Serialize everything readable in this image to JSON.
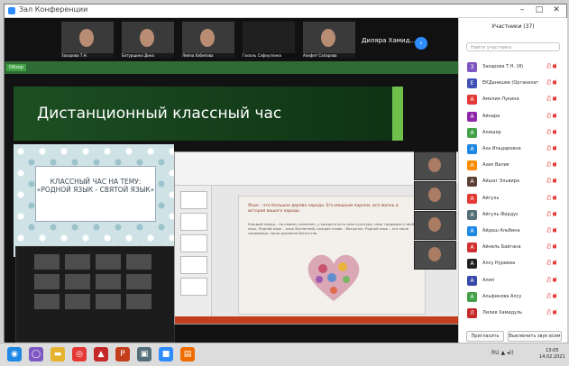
{
  "window": {
    "title": "Зал Конференции"
  },
  "gallery": {
    "participants": [
      {
        "name": "Захарова Т.Н."
      },
      {
        "name": "Ботурщина Дина"
      },
      {
        "name": "Лейла Хабипова"
      },
      {
        "name": ""
      },
      {
        "name": "Гюзаль Сафиуллина"
      },
      {
        "name": "Алифет Сапарова"
      }
    ],
    "speaker_name": "Диляра Хамид...",
    "next_icon": "chevron-right-icon"
  },
  "share": {
    "toolbar_badge": "Обзор",
    "title_slide": "Дистанционный классный час",
    "card_text": "КЛАССНЫЙ ЧАС НА ТЕМУ: «РОДНОЙ ЯЗЫК - СВЯТОЙ ЯЗЫК»",
    "ppt_slide_heading": "Язык – это большое дерево народа. Его мощным корнем, вся жизнь и история вашего народа",
    "ppt_slide_body": "Каждый народ – по-своему уникален, у каждого есть своя культура, свои традиции и свой язык. Родной язык – язык Вселенной, каждое слово – бесценно. Родной язык – это наше сокровище, наше духовное богатство."
  },
  "panel": {
    "title": "Участники (37)",
    "search_placeholder": "Найти участника",
    "participants": [
      {
        "name": "Захарова Т.Н. (Я)",
        "color": "#7e57c2",
        "letter": "З"
      },
      {
        "name": "ЕКДанишев (Организатор)",
        "color": "#3f51b5",
        "letter": "Е"
      },
      {
        "name": "Амелия Лукина",
        "color": "#e53935",
        "letter": "А"
      },
      {
        "name": "Айнара",
        "color": "#8e24aa",
        "letter": "А"
      },
      {
        "name": "Алишер",
        "color": "#43a047",
        "letter": "А"
      },
      {
        "name": "Аза Ильдаровна",
        "color": "#1e88e5",
        "letter": "А"
      },
      {
        "name": "Азик Валик",
        "color": "#fb8c00",
        "letter": "А"
      },
      {
        "name": "Айшат Эльвира",
        "color": "#5d4037",
        "letter": "А"
      },
      {
        "name": "Айгуль",
        "color": "#e53935",
        "letter": "А"
      },
      {
        "name": "Айгуль Фирдус",
        "color": "#546e7a",
        "letter": "А"
      },
      {
        "name": "Айдаш Альбина",
        "color": "#1e88e5",
        "letter": "А"
      },
      {
        "name": "Айнель Байгана",
        "color": "#d32f2f",
        "letter": "А"
      },
      {
        "name": "Алсу Нуриева",
        "color": "#212121",
        "letter": "А"
      },
      {
        "name": "Алия",
        "color": "#3949ab",
        "letter": "А"
      },
      {
        "name": "Альфинова Алсу",
        "color": "#43a047",
        "letter": "А"
      },
      {
        "name": "Лилия Хамидуль",
        "color": "#c62828",
        "letter": "Л"
      }
    ],
    "invite_button": "Пригласить",
    "mute_all_button": "Выключить звук всем"
  },
  "taskbar": {
    "apps": [
      {
        "icon": "start-icon",
        "color": "#1e88e5",
        "glyph": "◉"
      },
      {
        "icon": "browser-icon",
        "color": "#7e57c2",
        "glyph": "◯"
      },
      {
        "icon": "explorer-icon",
        "color": "#e6b32e",
        "glyph": "▬"
      },
      {
        "icon": "chrome-icon",
        "color": "#e53935",
        "glyph": "◎"
      },
      {
        "icon": "acrobat-icon",
        "color": "#c62828",
        "glyph": "▲"
      },
      {
        "icon": "powerpoint-icon",
        "color": "#c43e1c",
        "glyph": "P"
      },
      {
        "icon": "media-icon",
        "color": "#546e7a",
        "glyph": "▣"
      },
      {
        "icon": "zoom-icon",
        "color": "#2d8cff",
        "glyph": "■"
      },
      {
        "icon": "app-icon",
        "color": "#ef6c00",
        "glyph": "▤"
      }
    ],
    "tray": "RU  ▲  ◂))",
    "time": "13:05",
    "date": "14.02.2021"
  }
}
